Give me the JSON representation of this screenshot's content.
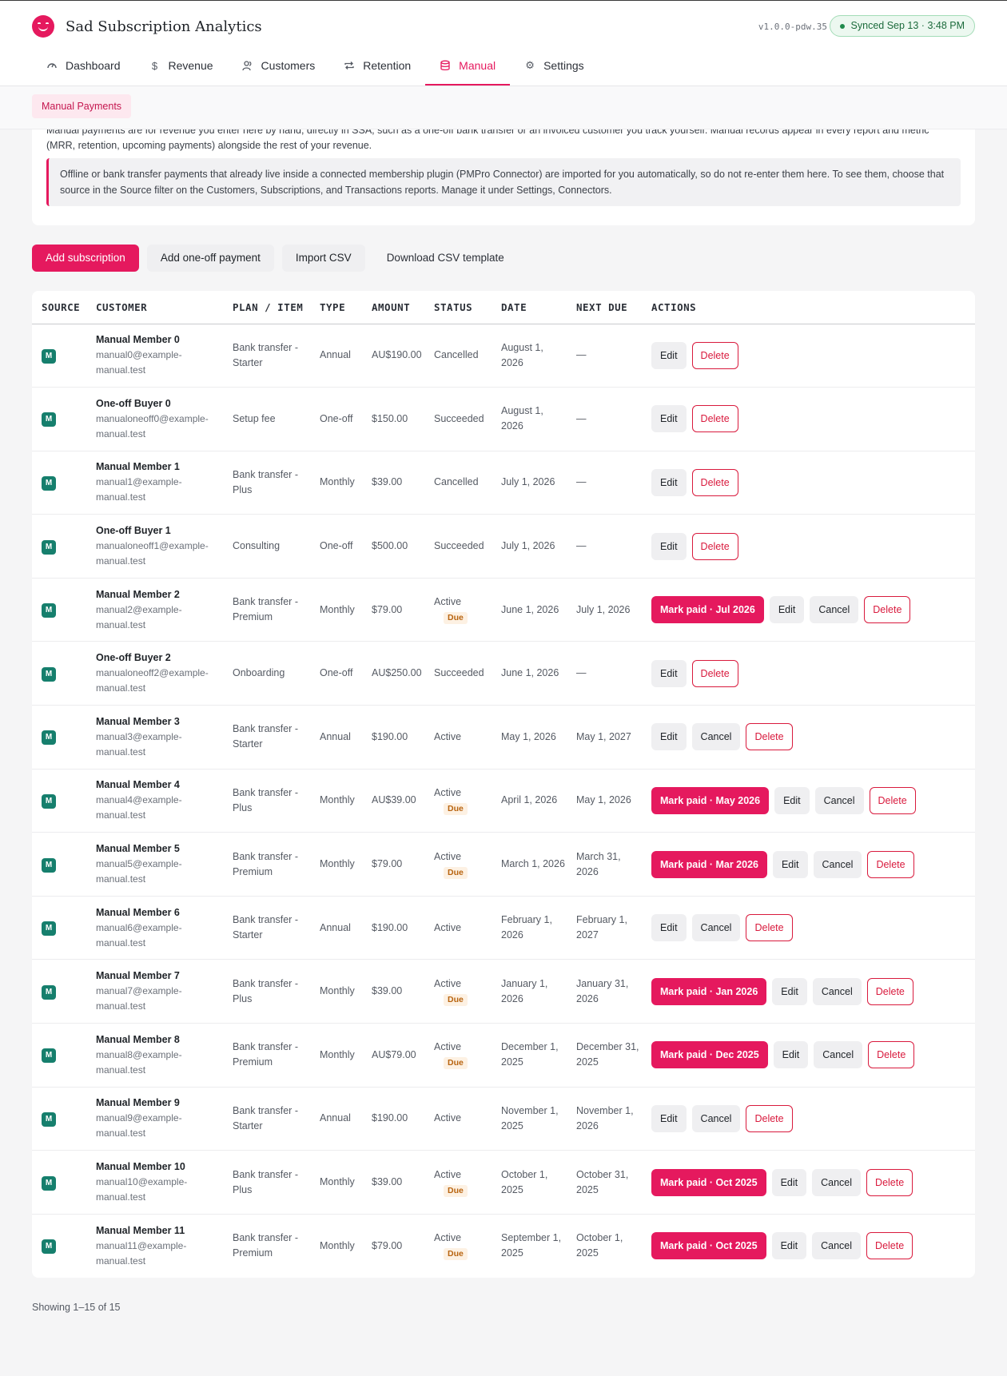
{
  "app": {
    "title": "Sad Subscription Analytics",
    "version": "v1.0.0-pdw.35",
    "sync_status": "Synced Sep 13 · 3:48 PM"
  },
  "nav": {
    "tabs": [
      {
        "label": "Dashboard",
        "icon": "gauge-icon"
      },
      {
        "label": "Revenue",
        "icon": "dollar-icon"
      },
      {
        "label": "Customers",
        "icon": "users-icon"
      },
      {
        "label": "Retention",
        "icon": "repeat-icon"
      },
      {
        "label": "Manual",
        "icon": "database-icon",
        "active": true
      },
      {
        "label": "Settings",
        "icon": "gear-icon"
      }
    ]
  },
  "subnav": {
    "label": "Manual Payments"
  },
  "intro": {
    "text": "Manual payments are for revenue you enter here by hand, directly in SSA, such as a one-off bank transfer or an invoiced customer you track yourself. Manual records appear in every report and metric (MRR, retention, upcoming payments) alongside the rest of your revenue.",
    "notice": "Offline or bank transfer payments that already live inside a connected membership plugin (PMPro Connector) are imported for you automatically, so do not re-enter them here. To see them, choose that source in the Source filter on the Customers, Subscriptions, and Transactions reports. Manage it under Settings, Connectors."
  },
  "toolbar": {
    "add_subscription": "Add subscription",
    "add_one_off": "Add one-off payment",
    "import_csv": "Import CSV",
    "download_template": "Download CSV template"
  },
  "table": {
    "headers": [
      "SOURCE",
      "CUSTOMER",
      "PLAN / ITEM",
      "TYPE",
      "AMOUNT",
      "STATUS",
      "DATE",
      "NEXT DUE",
      "ACTIONS"
    ],
    "rows": [
      {
        "source": "M",
        "name": "Manual Member 0",
        "email": "manual0@example-manual.test",
        "plan": "Bank transfer - Starter",
        "type": "Annual",
        "amount": "AU$190.00",
        "status": "Cancelled",
        "date": "August 1, 2026",
        "next_due": "—",
        "actions": [
          "Edit",
          "Delete"
        ]
      },
      {
        "source": "M",
        "name": "One-off Buyer 0",
        "email": "manualoneoff0@example-manual.test",
        "plan": "Setup fee",
        "type": "One-off",
        "amount": "$150.00",
        "status": "Succeeded",
        "date": "August 1, 2026",
        "next_due": "—",
        "actions": [
          "Edit",
          "Delete"
        ]
      },
      {
        "source": "M",
        "name": "Manual Member 1",
        "email": "manual1@example-manual.test",
        "plan": "Bank transfer - Plus",
        "type": "Monthly",
        "amount": "$39.00",
        "status": "Cancelled",
        "date": "July 1, 2026",
        "next_due": "—",
        "actions": [
          "Edit",
          "Delete"
        ]
      },
      {
        "source": "M",
        "name": "One-off Buyer 1",
        "email": "manualoneoff1@example-manual.test",
        "plan": "Consulting",
        "type": "One-off",
        "amount": "$500.00",
        "status": "Succeeded",
        "date": "July 1, 2026",
        "next_due": "—",
        "actions": [
          "Edit",
          "Delete"
        ]
      },
      {
        "source": "M",
        "name": "Manual Member 2",
        "email": "manual2@example-manual.test",
        "plan": "Bank transfer - Premium",
        "type": "Monthly",
        "amount": "$79.00",
        "status": "Active",
        "due": "Due",
        "date": "June 1, 2026",
        "next_due": "July 1, 2026",
        "mark_paid": "Mark paid · Jul 2026",
        "actions": [
          "Edit",
          "Cancel",
          "Delete"
        ]
      },
      {
        "source": "M",
        "name": "One-off Buyer 2",
        "email": "manualoneoff2@example-manual.test",
        "plan": "Onboarding",
        "type": "One-off",
        "amount": "AU$250.00",
        "status": "Succeeded",
        "date": "June 1, 2026",
        "next_due": "—",
        "actions": [
          "Edit",
          "Delete"
        ]
      },
      {
        "source": "M",
        "name": "Manual Member 3",
        "email": "manual3@example-manual.test",
        "plan": "Bank transfer - Starter",
        "type": "Annual",
        "amount": "$190.00",
        "status": "Active",
        "date": "May 1, 2026",
        "next_due": "May 1, 2027",
        "actions": [
          "Edit",
          "Cancel",
          "Delete"
        ]
      },
      {
        "source": "M",
        "name": "Manual Member 4",
        "email": "manual4@example-manual.test",
        "plan": "Bank transfer - Plus",
        "type": "Monthly",
        "amount": "AU$39.00",
        "status": "Active",
        "due": "Due",
        "date": "April 1, 2026",
        "next_due": "May 1, 2026",
        "mark_paid": "Mark paid · May 2026",
        "actions": [
          "Edit",
          "Cancel",
          "Delete"
        ]
      },
      {
        "source": "M",
        "name": "Manual Member 5",
        "email": "manual5@example-manual.test",
        "plan": "Bank transfer - Premium",
        "type": "Monthly",
        "amount": "$79.00",
        "status": "Active",
        "due": "Due",
        "date": "March 1, 2026",
        "next_due": "March 31, 2026",
        "mark_paid": "Mark paid · Mar 2026",
        "actions": [
          "Edit",
          "Cancel",
          "Delete"
        ]
      },
      {
        "source": "M",
        "name": "Manual Member 6",
        "email": "manual6@example-manual.test",
        "plan": "Bank transfer - Starter",
        "type": "Annual",
        "amount": "$190.00",
        "status": "Active",
        "date": "February 1, 2026",
        "next_due": "February 1, 2027",
        "actions": [
          "Edit",
          "Cancel",
          "Delete"
        ]
      },
      {
        "source": "M",
        "name": "Manual Member 7",
        "email": "manual7@example-manual.test",
        "plan": "Bank transfer - Plus",
        "type": "Monthly",
        "amount": "$39.00",
        "status": "Active",
        "due": "Due",
        "date": "January 1, 2026",
        "next_due": "January 31, 2026",
        "mark_paid": "Mark paid · Jan 2026",
        "actions": [
          "Edit",
          "Cancel",
          "Delete"
        ]
      },
      {
        "source": "M",
        "name": "Manual Member 8",
        "email": "manual8@example-manual.test",
        "plan": "Bank transfer - Premium",
        "type": "Monthly",
        "amount": "AU$79.00",
        "status": "Active",
        "due": "Due",
        "date": "December 1, 2025",
        "next_due": "December 31, 2025",
        "mark_paid": "Mark paid · Dec 2025",
        "actions": [
          "Edit",
          "Cancel",
          "Delete"
        ]
      },
      {
        "source": "M",
        "name": "Manual Member 9",
        "email": "manual9@example-manual.test",
        "plan": "Bank transfer - Starter",
        "type": "Annual",
        "amount": "$190.00",
        "status": "Active",
        "date": "November 1, 2025",
        "next_due": "November 1, 2026",
        "actions": [
          "Edit",
          "Cancel",
          "Delete"
        ]
      },
      {
        "source": "M",
        "name": "Manual Member 10",
        "email": "manual10@example-manual.test",
        "plan": "Bank transfer - Plus",
        "type": "Monthly",
        "amount": "$39.00",
        "status": "Active",
        "due": "Due",
        "date": "October 1, 2025",
        "next_due": "October 31, 2025",
        "mark_paid": "Mark paid · Oct 2025",
        "actions": [
          "Edit",
          "Cancel",
          "Delete"
        ]
      },
      {
        "source": "M",
        "name": "Manual Member 11",
        "email": "manual11@example-manual.test",
        "plan": "Bank transfer - Premium",
        "type": "Monthly",
        "amount": "$79.00",
        "status": "Active",
        "due": "Due",
        "date": "September 1, 2025",
        "next_due": "October 1, 2025",
        "mark_paid": "Mark paid · Oct 2025",
        "actions": [
          "Edit",
          "Cancel",
          "Delete"
        ]
      }
    ]
  },
  "pagination": {
    "summary": "Showing 1–15 of 15"
  },
  "colors": {
    "accent": "#e5195e",
    "source_badge": "#167f6d",
    "due_badge": "#b86410",
    "sync_green": "#1f8a4c"
  }
}
